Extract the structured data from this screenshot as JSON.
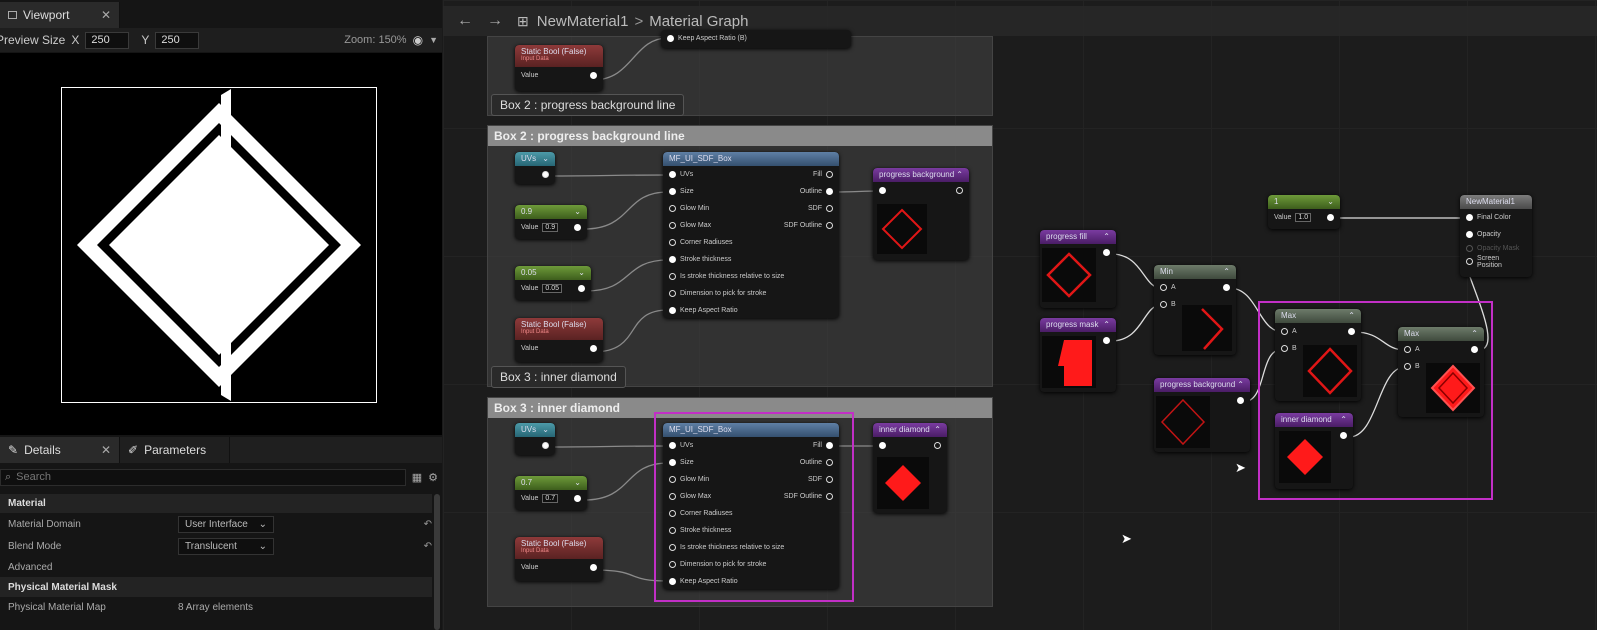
{
  "viewport": {
    "tab": "Viewport",
    "preview_label": "Preview Size",
    "x_label": "X",
    "x_value": "250",
    "y_label": "Y",
    "y_value": "250",
    "zoom": "Zoom: 150%"
  },
  "details": {
    "tab": "Details",
    "params_tab": "Parameters",
    "search_placeholder": "Search",
    "section_material": "Material",
    "domain_label": "Material Domain",
    "domain_value": "User Interface",
    "blend_label": "Blend Mode",
    "blend_value": "Translucent",
    "advanced": "Advanced",
    "section_pmm": "Physical Material Mask",
    "pmm_label": "Physical Material Map",
    "pmm_value": "8 Array elements"
  },
  "breadcrumb": {
    "asset": "NewMaterial1",
    "sep": ">",
    "graph": "Material Graph"
  },
  "comments": {
    "box2_top_footer": "Box 2 : progress background line",
    "box2_title": "Box 2 : progress background line",
    "box2_footer": "Box 3 : inner diamond",
    "box3_title": "Box 3 : inner diamond"
  },
  "nodes": {
    "uvs": "UVs",
    "sdf_title": "MF_UI_SDF_Box",
    "static_bool": "Static Bool (False)",
    "input_data": "Input Data",
    "value": "Value",
    "keep_aspect_top": "Keep Aspect Ratio (B)",
    "c09": "0.9",
    "c005": "0.05",
    "c07": "0.7",
    "v09": "0.9",
    "v005": "0.05",
    "v07": "0.7",
    "in_uvs": "UVs",
    "in_size": "Size",
    "in_glowmin": "Glow Min",
    "in_glowmax": "Glow Max",
    "in_corner": "Corner Radiuses",
    "in_stroke": "Stroke thickness",
    "in_rel": "Is stroke thickness relative to size",
    "in_dim": "Dimension to pick for stroke",
    "in_keep": "Keep Aspect Ratio",
    "out_fill": "Fill",
    "out_outline": "Outline",
    "out_sdf": "SDF",
    "out_sdfoutline": "SDF Outline",
    "progress_background": "progress background",
    "inner_diamond": "inner diamond",
    "progress_fill": "progress fill",
    "progress_mask": "progress mask",
    "min": "Min",
    "max": "Max",
    "pin_a": "A",
    "pin_b": "B",
    "const1": "1",
    "const1_value": "1.0",
    "result": "NewMaterial1",
    "final_color": "Final Color",
    "opacity": "Opacity",
    "opacity_mask": "Opacity Mask",
    "screen_position": "Screen Position"
  },
  "colors": {
    "selection": "#c22fc6",
    "preview_red": "#ff1a1a"
  }
}
